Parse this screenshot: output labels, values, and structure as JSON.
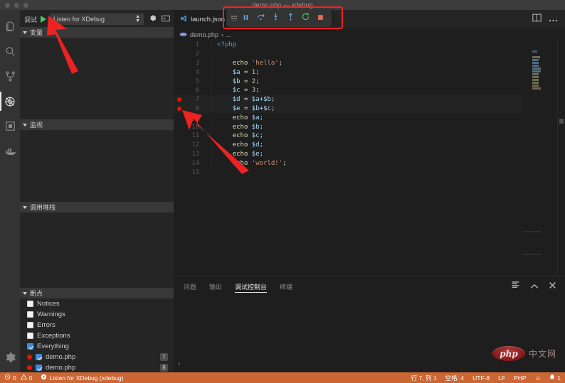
{
  "window": {
    "title": "demo.php — xdebug",
    "traffic_lights": [
      "close",
      "minimize",
      "maximize"
    ]
  },
  "activitybar": {
    "items": [
      {
        "name": "explorer",
        "icon": "files-icon",
        "active": false
      },
      {
        "name": "search",
        "icon": "search-icon",
        "active": false
      },
      {
        "name": "source-control",
        "icon": "source-control-icon",
        "active": false
      },
      {
        "name": "run-and-debug",
        "icon": "debug-icon",
        "active": true
      },
      {
        "name": "extensions",
        "icon": "extensions-icon",
        "active": false
      },
      {
        "name": "docker",
        "icon": "docker-icon",
        "active": false
      }
    ],
    "bottom": [
      {
        "name": "manage",
        "icon": "gear-icon"
      }
    ]
  },
  "sidebar": {
    "debug_label": "调试",
    "run_button": "start-debugging",
    "configuration": "Listen for XDebug",
    "config_options": [
      "Listen for XDebug"
    ],
    "gear_icon": "gear-icon",
    "console_icon": "open-debug-console-icon",
    "panes": [
      {
        "name": "variables",
        "title": "变量",
        "items": []
      },
      {
        "name": "watch",
        "title": "监视",
        "items": []
      },
      {
        "name": "call-stack",
        "title": "调用堆栈",
        "items": []
      }
    ],
    "breakpoints": {
      "title": "断点",
      "items": [
        {
          "label": "Notices",
          "checked": false,
          "dot": false,
          "line": ""
        },
        {
          "label": "Warnings",
          "checked": false,
          "dot": false,
          "line": ""
        },
        {
          "label": "Errors",
          "checked": false,
          "dot": false,
          "line": ""
        },
        {
          "label": "Exceptions",
          "checked": false,
          "dot": false,
          "line": ""
        },
        {
          "label": "Everything",
          "checked": true,
          "dot": false,
          "line": ""
        },
        {
          "label": "demo.php",
          "checked": true,
          "dot": true,
          "line": "7"
        },
        {
          "label": "demo.php",
          "checked": true,
          "dot": true,
          "line": "8"
        }
      ]
    }
  },
  "debug_toolbar": {
    "buttons": [
      {
        "name": "drag-handle",
        "icon": "grip-icon",
        "color": "#8a8a8a"
      },
      {
        "name": "pause",
        "icon": "pause-icon",
        "color": "#6aa9e0"
      },
      {
        "name": "step-over",
        "icon": "step-over-icon",
        "color": "#6aa9e0"
      },
      {
        "name": "step-into",
        "icon": "step-into-icon",
        "color": "#6aa9e0"
      },
      {
        "name": "step-out",
        "icon": "step-out-icon",
        "color": "#6aa9e0"
      },
      {
        "name": "restart",
        "icon": "restart-icon",
        "color": "#54c06a"
      },
      {
        "name": "stop",
        "icon": "stop-icon",
        "color": "#e06c55"
      }
    ]
  },
  "editor": {
    "tabs": [
      {
        "label": "launch.json",
        "icon": "vscode-icon",
        "active": true
      }
    ],
    "actions": [
      {
        "name": "split-editor",
        "icon": "split-editor-icon"
      },
      {
        "name": "more-actions",
        "icon": "ellipsis-icon"
      }
    ],
    "breadcrumb": {
      "icon": "php-file-icon",
      "file": "demo.php",
      "separator": "›",
      "rest": "..."
    },
    "code": [
      {
        "num": "1",
        "breakpoint": false,
        "tokens": [
          {
            "t": "<?php",
            "c": "kw"
          }
        ]
      },
      {
        "num": "2",
        "breakpoint": false,
        "tokens": []
      },
      {
        "num": "3",
        "breakpoint": false,
        "tokens": [
          {
            "t": "    ",
            "c": "op"
          },
          {
            "t": "echo",
            "c": "fn"
          },
          {
            "t": " ",
            "c": "op"
          },
          {
            "t": "'hello'",
            "c": "str"
          },
          {
            "t": ";",
            "c": "op"
          }
        ]
      },
      {
        "num": "4",
        "breakpoint": false,
        "tokens": [
          {
            "t": "    ",
            "c": "op"
          },
          {
            "t": "$a",
            "c": "var"
          },
          {
            "t": " = ",
            "c": "op"
          },
          {
            "t": "1",
            "c": "num"
          },
          {
            "t": ";",
            "c": "op"
          }
        ]
      },
      {
        "num": "5",
        "breakpoint": false,
        "tokens": [
          {
            "t": "    ",
            "c": "op"
          },
          {
            "t": "$b",
            "c": "var"
          },
          {
            "t": " = ",
            "c": "op"
          },
          {
            "t": "2",
            "c": "num"
          },
          {
            "t": ";",
            "c": "op"
          }
        ]
      },
      {
        "num": "6",
        "breakpoint": false,
        "tokens": [
          {
            "t": "    ",
            "c": "op"
          },
          {
            "t": "$c",
            "c": "var"
          },
          {
            "t": " = ",
            "c": "op"
          },
          {
            "t": "3",
            "c": "num"
          },
          {
            "t": ";",
            "c": "op"
          }
        ]
      },
      {
        "num": "7",
        "breakpoint": true,
        "tokens": [
          {
            "t": "    ",
            "c": "op"
          },
          {
            "t": "$d",
            "c": "var"
          },
          {
            "t": " = ",
            "c": "op"
          },
          {
            "t": "$a",
            "c": "var"
          },
          {
            "t": "+",
            "c": "op"
          },
          {
            "t": "$b",
            "c": "var"
          },
          {
            "t": ";",
            "c": "op"
          }
        ]
      },
      {
        "num": "8",
        "breakpoint": true,
        "tokens": [
          {
            "t": "    ",
            "c": "op"
          },
          {
            "t": "$e",
            "c": "var"
          },
          {
            "t": " = ",
            "c": "op"
          },
          {
            "t": "$b",
            "c": "var"
          },
          {
            "t": "+",
            "c": "op"
          },
          {
            "t": "$c",
            "c": "var"
          },
          {
            "t": ";",
            "c": "op"
          }
        ]
      },
      {
        "num": "9",
        "breakpoint": false,
        "tokens": [
          {
            "t": "    ",
            "c": "op"
          },
          {
            "t": "echo",
            "c": "fn"
          },
          {
            "t": " ",
            "c": "op"
          },
          {
            "t": "$a",
            "c": "var"
          },
          {
            "t": ";",
            "c": "op"
          }
        ]
      },
      {
        "num": "10",
        "breakpoint": false,
        "tokens": [
          {
            "t": "    ",
            "c": "op"
          },
          {
            "t": "echo",
            "c": "fn"
          },
          {
            "t": " ",
            "c": "op"
          },
          {
            "t": "$b",
            "c": "var"
          },
          {
            "t": ";",
            "c": "op"
          }
        ]
      },
      {
        "num": "11",
        "breakpoint": false,
        "tokens": [
          {
            "t": "    ",
            "c": "op"
          },
          {
            "t": "echo",
            "c": "fn"
          },
          {
            "t": " ",
            "c": "op"
          },
          {
            "t": "$c",
            "c": "var"
          },
          {
            "t": ";",
            "c": "op"
          }
        ]
      },
      {
        "num": "12",
        "breakpoint": false,
        "tokens": [
          {
            "t": "    ",
            "c": "op"
          },
          {
            "t": "echo",
            "c": "fn"
          },
          {
            "t": " ",
            "c": "op"
          },
          {
            "t": "$d",
            "c": "var"
          },
          {
            "t": ";",
            "c": "op"
          }
        ]
      },
      {
        "num": "13",
        "breakpoint": false,
        "tokens": [
          {
            "t": "    ",
            "c": "op"
          },
          {
            "t": "echo",
            "c": "fn"
          },
          {
            "t": " ",
            "c": "op"
          },
          {
            "t": "$e",
            "c": "var"
          },
          {
            "t": ";",
            "c": "op"
          }
        ]
      },
      {
        "num": "14",
        "breakpoint": false,
        "tokens": [
          {
            "t": "    ",
            "c": "op"
          },
          {
            "t": "echo",
            "c": "fn"
          },
          {
            "t": " ",
            "c": "op"
          },
          {
            "t": "'world!'",
            "c": "str"
          },
          {
            "t": ";",
            "c": "op"
          }
        ]
      },
      {
        "num": "15",
        "breakpoint": false,
        "tokens": []
      }
    ]
  },
  "panel": {
    "tabs": [
      {
        "label": "问题",
        "active": false
      },
      {
        "label": "输出",
        "active": false
      },
      {
        "label": "调试控制台",
        "active": true
      },
      {
        "label": "终端",
        "active": false
      }
    ],
    "actions": [
      {
        "name": "clear-console",
        "icon": "clear-console-icon"
      },
      {
        "name": "maximize-panel",
        "icon": "chevron-up-icon"
      },
      {
        "name": "close-panel",
        "icon": "close-icon"
      }
    ],
    "prompt": "›"
  },
  "watermark": {
    "logo": "php",
    "text": "中文网"
  },
  "statusbar": {
    "background": "#cc6633",
    "left": [
      {
        "name": "problems",
        "icon": "error-icon",
        "errors": "0",
        "warn_icon": "warning-icon",
        "warnings": "0"
      },
      {
        "name": "debug-session",
        "icon": "play-icon",
        "label": "Listen for XDebug (xdebug)"
      }
    ],
    "right": [
      {
        "name": "cursor-position",
        "label": "行 7, 列 1"
      },
      {
        "name": "indentation",
        "label": "空格: 4"
      },
      {
        "name": "encoding",
        "label": "UTF-8"
      },
      {
        "name": "eol",
        "label": "LF"
      },
      {
        "name": "language-mode",
        "label": "PHP"
      },
      {
        "name": "feedback",
        "label": "☺"
      },
      {
        "name": "notifications",
        "label": "1"
      }
    ]
  },
  "annotations": {
    "highlight_box": "debug-toolbar-highlight",
    "arrows": [
      {
        "name": "arrow-to-run-button",
        "target": "start-debugging"
      },
      {
        "name": "arrow-to-breakpoints",
        "target": "editor-breakpoints"
      }
    ],
    "color": "#ee2222"
  }
}
